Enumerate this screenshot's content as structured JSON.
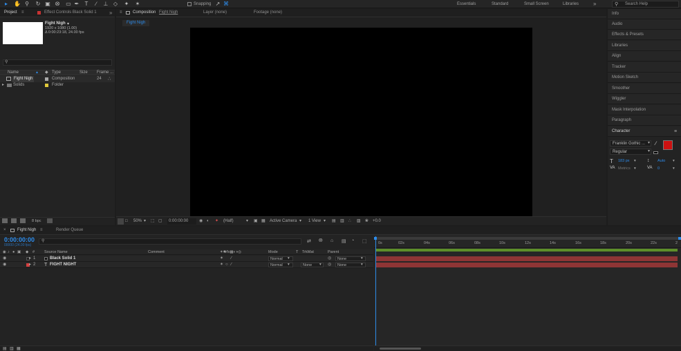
{
  "toolbar": {
    "snapping_label": "Snapping",
    "workspaces": [
      "Essentials",
      "Standard",
      "Small Screen",
      "Libraries"
    ],
    "search_placeholder": "Search Help"
  },
  "project": {
    "tab_project": "Project",
    "tab_effect_controls": "Effect Controls Black Solid 1",
    "comp_name": "Fight Nigh",
    "comp_info_1": "1920 x 1080 (1.00)",
    "comp_info_2": "Δ 0:00:23:18, 24.00 fps",
    "columns": {
      "name": "Name",
      "type": "Type",
      "size": "Size",
      "frame": "Frame ..."
    },
    "items": [
      {
        "name": "Fight Nigh",
        "type": "Composition",
        "fps": "24",
        "color": "#a9a9a9"
      },
      {
        "name": "Solids",
        "type": "Folder",
        "fps": "",
        "color": "#e0c93a"
      }
    ],
    "bpc": "8 bpc"
  },
  "viewer": {
    "tab_composition_prefix": "Composition",
    "tab_composition_name": "Fight Nigh",
    "tab_layer": "Layer (none)",
    "tab_footage": "Footage (none)",
    "sub_tab": "Fight Nigh",
    "zoom": "50%",
    "timecode": "0:00:00:00",
    "resolution": "(Half)",
    "camera": "Active Camera",
    "view": "1 View",
    "exposure": "+0.0"
  },
  "right_panels": [
    "Info",
    "Audio",
    "Effects & Presets",
    "Libraries",
    "Align",
    "Tracker",
    "Motion Sketch",
    "Smoother",
    "Wiggler",
    "Mask Interpolation",
    "Paragraph",
    "Character"
  ],
  "character": {
    "font": "Franklin Gothic ...",
    "style": "Regular",
    "size": "183 px",
    "leading": "Auto",
    "kerning": "Metrics",
    "tracking": "0",
    "fill_color": "#cc1111"
  },
  "timeline": {
    "tab_comp": "Fight Nigh",
    "tab_render": "Render Queue",
    "timecode": "0:00:00:00",
    "fps_info": "00000 (24.00 fps)",
    "columns": {
      "num": "#",
      "source": "Source Name",
      "comment": "Comment",
      "mode": "Mode",
      "t": "T",
      "trkmat": "TrkMat",
      "parent": "Parent"
    },
    "ruler": [
      "0s",
      "02s",
      "04s",
      "06s",
      "08s",
      "10s",
      "12s",
      "14s",
      "16s",
      "18s",
      "20s",
      "22s",
      "2"
    ],
    "layers": [
      {
        "num": "1",
        "name": "Black Solid 1",
        "mode": "Normal",
        "trkmat": "",
        "parent": "None",
        "bar_color": "#8e3535",
        "label_color": "#202020"
      },
      {
        "num": "2",
        "name": "FIGHT NIGHT",
        "mode": "Normal",
        "trkmat": "None",
        "parent": "None",
        "bar_color": "#8e3535",
        "label_color": "#d44040"
      }
    ],
    "work_area_color": "#6e9a2f"
  }
}
